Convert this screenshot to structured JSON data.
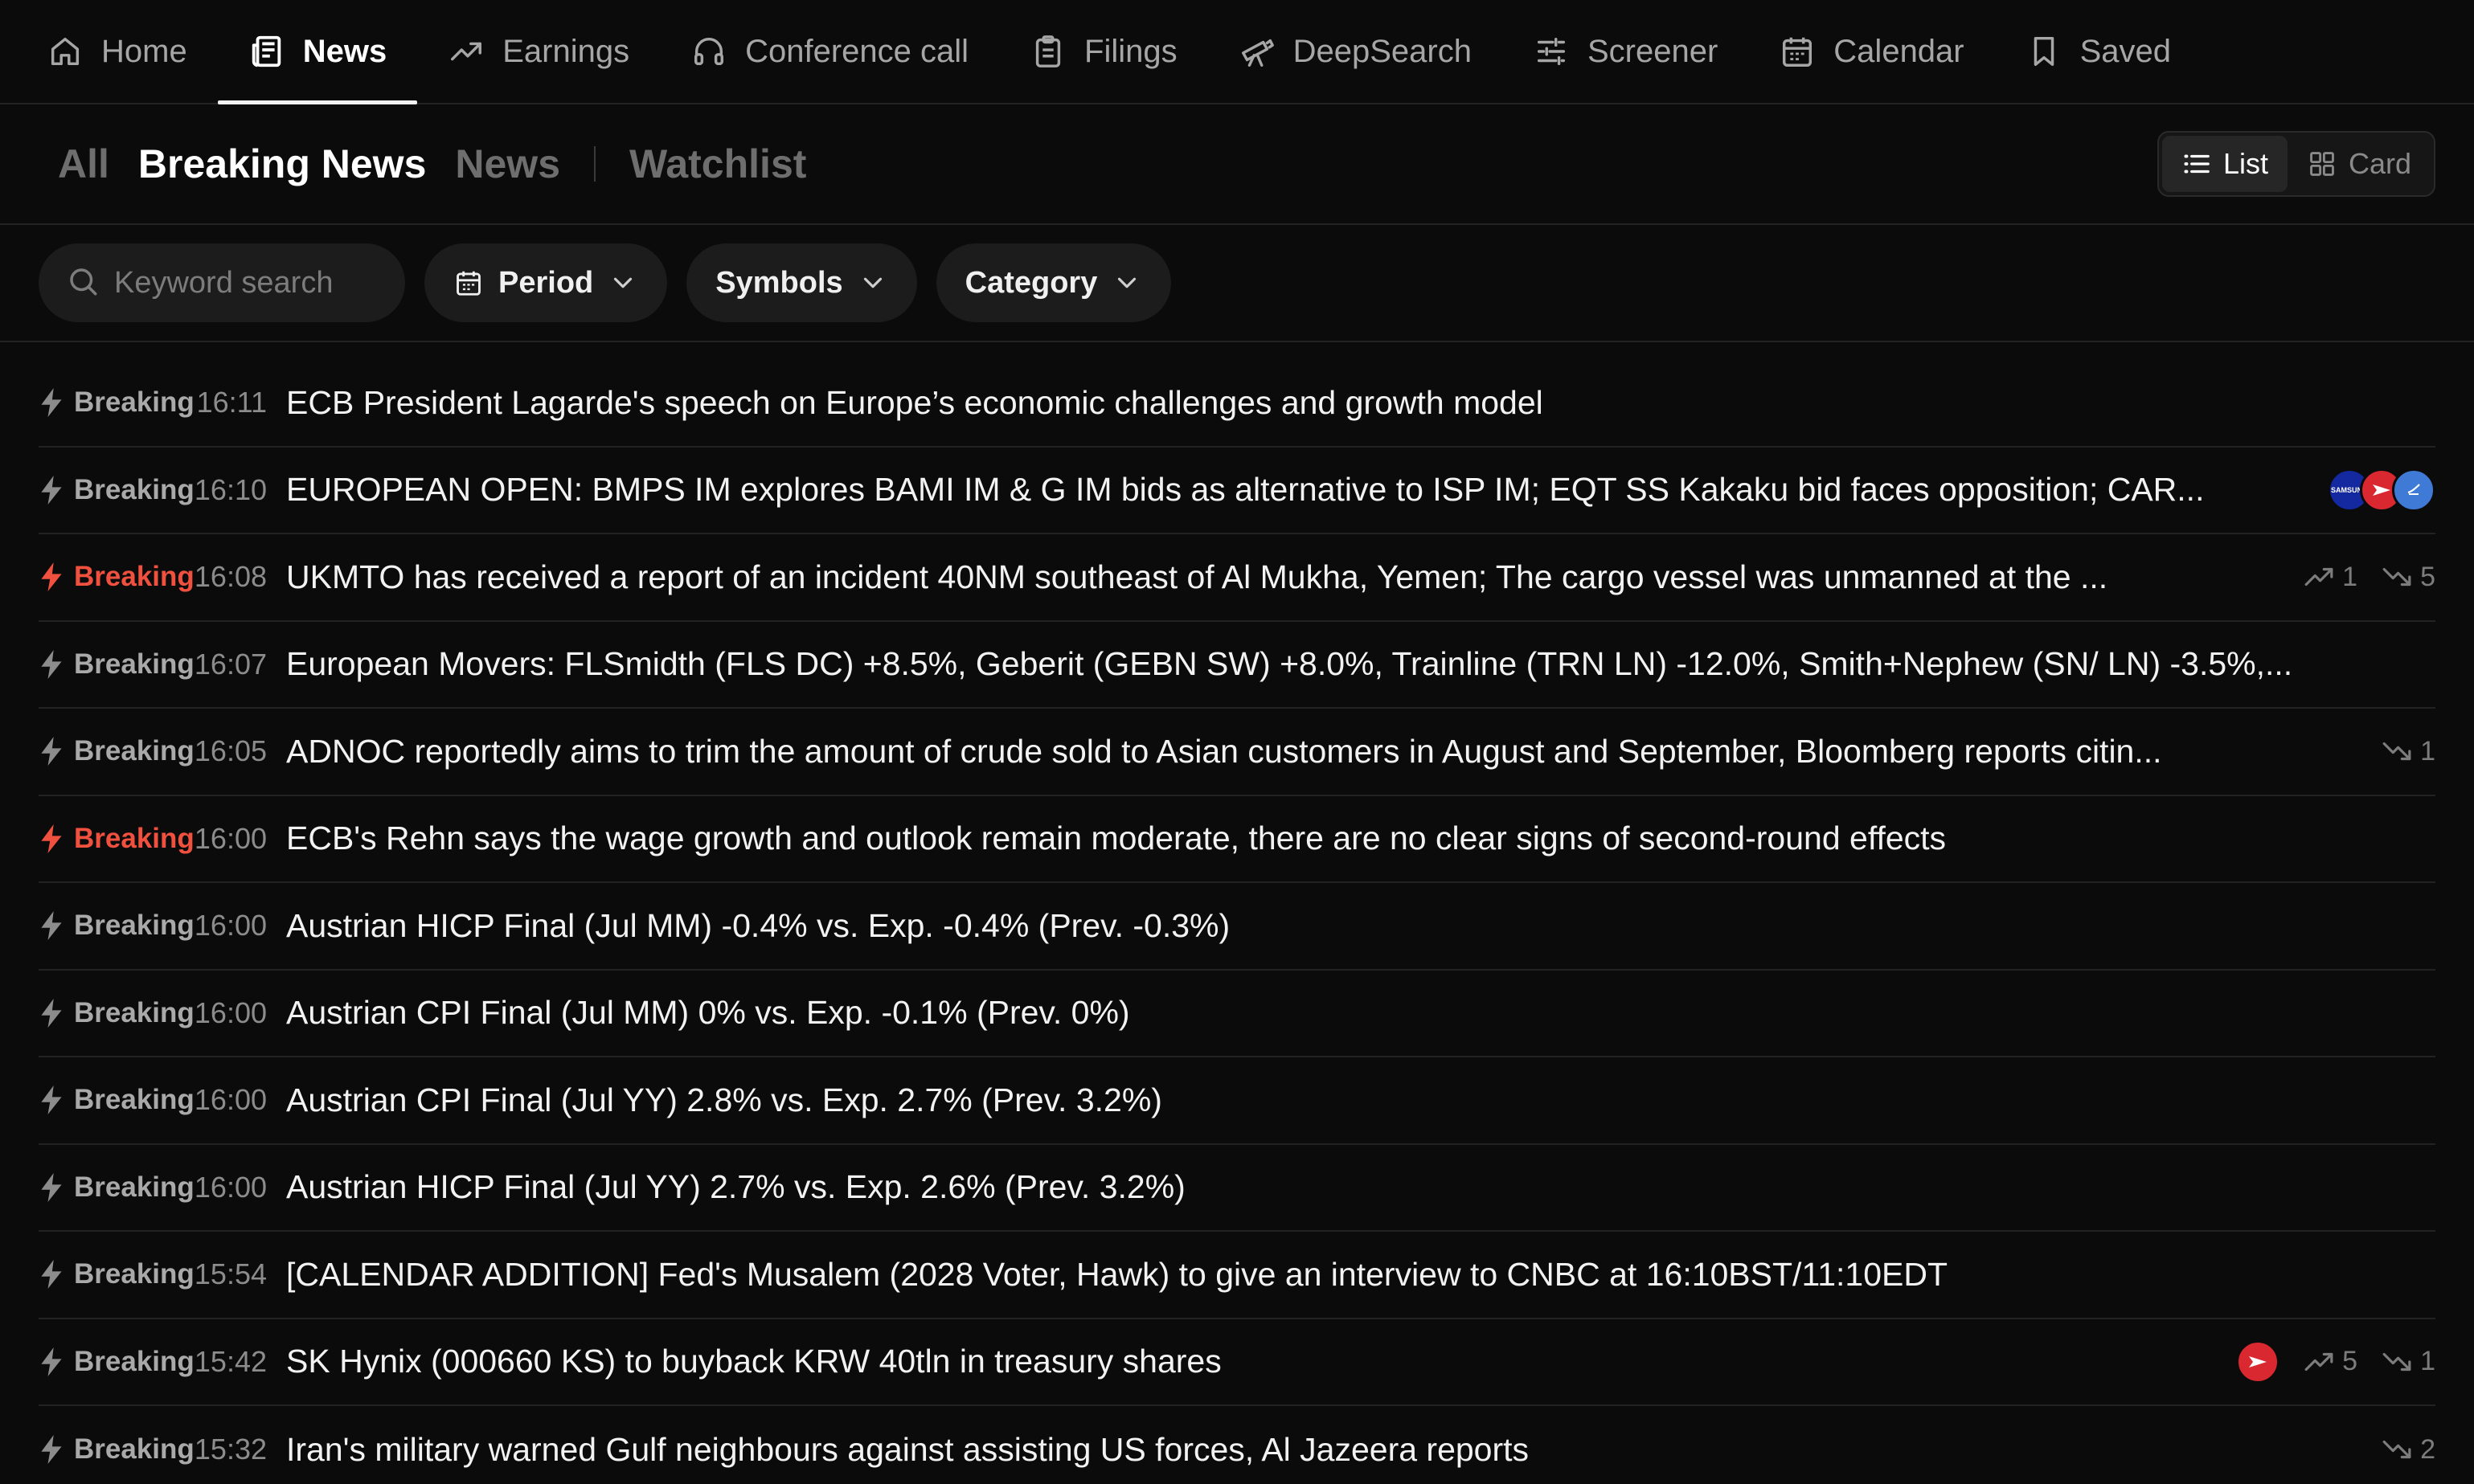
{
  "nav": [
    {
      "label": "Home",
      "icon": "home-icon"
    },
    {
      "label": "News",
      "icon": "newspaper-icon"
    },
    {
      "label": "Earnings",
      "icon": "trend-up-icon"
    },
    {
      "label": "Conference call",
      "icon": "headphones-icon"
    },
    {
      "label": "Filings",
      "icon": "clipboard-icon"
    },
    {
      "label": "DeepSearch",
      "icon": "telescope-icon"
    },
    {
      "label": "Screener",
      "icon": "sliders-icon"
    },
    {
      "label": "Calendar",
      "icon": "calendar-icon"
    },
    {
      "label": "Saved",
      "icon": "bookmark-icon"
    }
  ],
  "subtabs": {
    "all": "All",
    "breaking": "Breaking News",
    "news": "News",
    "watchlist": "Watchlist"
  },
  "view_toggle": {
    "list": "List",
    "card": "Card"
  },
  "filters": {
    "search_placeholder": "Keyword search",
    "period": "Period",
    "symbols": "Symbols",
    "category": "Category"
  },
  "colors": {
    "background": "#0b0b0b",
    "breaking_hot": "#f0513f",
    "breaking_normal": "#a9a9a9"
  },
  "rows": [
    {
      "tag": "Breaking",
      "time": "16:11",
      "headline": "ECB President Lagarde's speech on Europe’s economic challenges and growth model"
    },
    {
      "tag": "Breaking",
      "time": "16:10",
      "headline": "EUROPEAN OPEN: BMPS IM explores BAMI IM & G IM bids as alternative to ISP IM; EQT SS Kakaku bid faces opposition; CAR...",
      "logo_samsung_text": "SAMSUNG"
    },
    {
      "tag": "Breaking",
      "time": "16:08",
      "headline": "UKMTO has received a report of an incident 40NM southeast of Al Mukha, Yemen; The cargo vessel was unmanned at the ...",
      "up": "1",
      "down": "5"
    },
    {
      "tag": "Breaking",
      "time": "16:07",
      "headline": "European Movers: FLSmidth (FLS DC) +8.5%, Geberit (GEBN SW) +8.0%, Trainline (TRN LN) -12.0%, Smith+Nephew (SN/ LN) -3.5%,..."
    },
    {
      "tag": "Breaking",
      "time": "16:05",
      "headline": "ADNOC reportedly aims to trim the amount of crude sold to Asian customers in August and September, Bloomberg reports citin...",
      "down": "1"
    },
    {
      "tag": "Breaking",
      "time": "16:00",
      "headline": "ECB's Rehn says the wage growth and outlook remain moderate, there are no clear signs of second-round effects"
    },
    {
      "tag": "Breaking",
      "time": "16:00",
      "headline": "Austrian HICP Final (Jul MM) -0.4% vs. Exp. -0.4% (Prev. -0.3%)"
    },
    {
      "tag": "Breaking",
      "time": "16:00",
      "headline": "Austrian CPI Final (Jul MM) 0% vs. Exp. -0.1% (Prev. 0%)"
    },
    {
      "tag": "Breaking",
      "time": "16:00",
      "headline": "Austrian CPI Final (Jul YY) 2.8% vs. Exp. 2.7% (Prev. 3.2%)"
    },
    {
      "tag": "Breaking",
      "time": "16:00",
      "headline": "Austrian HICP Final (Jul YY) 2.7% vs. Exp. 2.6% (Prev. 3.2%)"
    },
    {
      "tag": "Breaking",
      "time": "15:54",
      "headline": "[CALENDAR ADDITION] Fed's Musalem (2028 Voter, Hawk) to give an interview to CNBC at 16:10BST/11:10EDT"
    },
    {
      "tag": "Breaking",
      "time": "15:42",
      "headline": "SK Hynix (000660 KS) to buyback KRW 40tln in treasury shares",
      "up": "5",
      "down": "1"
    },
    {
      "tag": "Breaking",
      "time": "15:32",
      "headline": "Iran's military warned Gulf neighbours against assisting US forces, Al Jazeera reports",
      "down": "2"
    }
  ]
}
